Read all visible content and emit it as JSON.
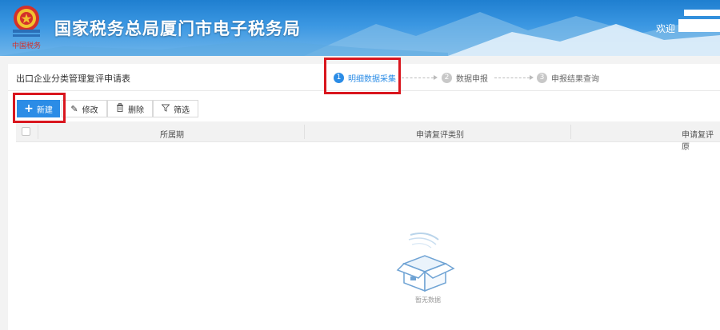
{
  "header": {
    "emblem_label": "中国税务",
    "title": "国家税务总局厦门市电子税务局",
    "welcome": "欢迎"
  },
  "form": {
    "title": "出口企业分类管理复评申请表"
  },
  "steps": [
    {
      "num": "1",
      "label": "明细数据采集",
      "active": true
    },
    {
      "num": "2",
      "label": "数据申报",
      "active": false
    },
    {
      "num": "3",
      "label": "申报结果查询",
      "active": false
    }
  ],
  "toolbar": {
    "new_label": "新建",
    "edit_label": "修改",
    "delete_label": "删除",
    "filter_label": "筛选"
  },
  "table": {
    "columns": [
      "所属期",
      "申请复评类别",
      "申请复评原"
    ]
  },
  "empty": {
    "text": "暂无数据"
  },
  "colors": {
    "accent": "#2b8ce6",
    "highlight": "#d9161e",
    "banner": "#3b97e2"
  }
}
